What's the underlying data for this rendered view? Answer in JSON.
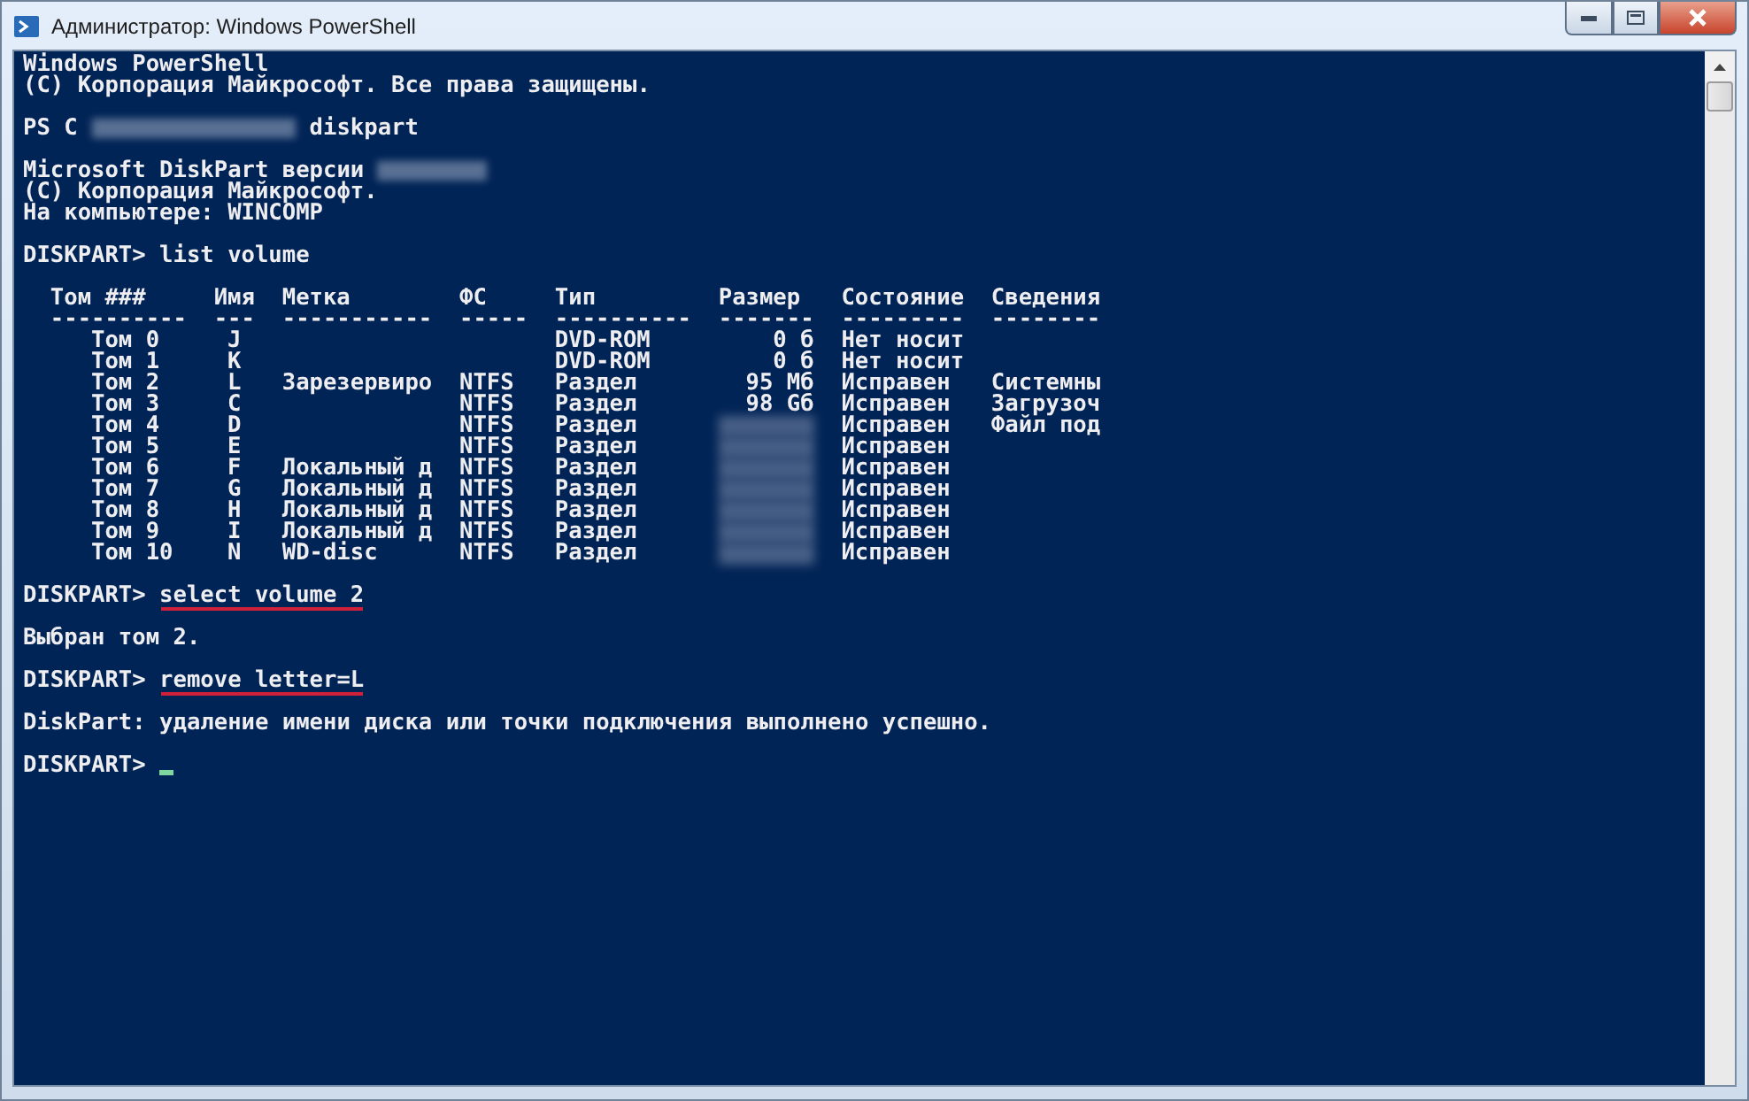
{
  "window": {
    "title": "Администратор: Windows PowerShell"
  },
  "console": {
    "lines_before": [
      {
        "kind": "text",
        "text": "Windows PowerShell"
      },
      {
        "kind": "text",
        "text": "(C) Корпорация Майкрософт. Все права защищены."
      },
      {
        "kind": "blank"
      },
      {
        "kind": "redacted",
        "before": "PS C",
        "after": "diskpart"
      },
      {
        "kind": "blank"
      },
      {
        "kind": "redacted",
        "before": "Microsoft DiskPart версии"
      },
      {
        "kind": "text",
        "text": "(C) Корпорация Майкрософт."
      },
      {
        "kind": "text",
        "text": "На компьютере: WINCOMP"
      },
      {
        "kind": "blank"
      },
      {
        "kind": "command",
        "prompt": "DISKPART>",
        "command": "list volume",
        "underlined": false
      },
      {
        "kind": "blank"
      }
    ],
    "table": {
      "columns": [
        {
          "header": "Том ###",
          "rule": "----------"
        },
        {
          "header": "Имя",
          "rule": "---"
        },
        {
          "header": "Метка",
          "rule": "-----------"
        },
        {
          "header": "ФС",
          "rule": "-----"
        },
        {
          "header": "Тип",
          "rule": "----------"
        },
        {
          "header": "Размер",
          "rule": "-------"
        },
        {
          "header": "Состояние",
          "rule": "---------"
        },
        {
          "header": "Сведения",
          "rule": "--------"
        }
      ],
      "rows": [
        {
          "cells": [
            "Том 0",
            "J",
            "",
            "",
            "DVD-ROM",
            "0 б",
            "Нет носит",
            ""
          ],
          "size_redacted": false
        },
        {
          "cells": [
            "Том 1",
            "K",
            "",
            "",
            "DVD-ROM",
            "0 б",
            "Нет носит",
            ""
          ],
          "size_redacted": false
        },
        {
          "cells": [
            "Том 2",
            "L",
            "Зарезервиро",
            "NTFS",
            "Раздел",
            "95 Мб",
            "Исправен",
            "Системны"
          ],
          "size_redacted": false
        },
        {
          "cells": [
            "Том 3",
            "C",
            "",
            "NTFS",
            "Раздел",
            "98 Gб",
            "Исправен",
            "Загрузоч"
          ],
          "size_redacted": false
        },
        {
          "cells": [
            "Том 4",
            "D",
            "",
            "NTFS",
            "Раздел",
            "",
            "Исправен",
            "Файл под"
          ],
          "size_redacted": true
        },
        {
          "cells": [
            "Том 5",
            "E",
            "",
            "NTFS",
            "Раздел",
            "",
            "Исправен",
            ""
          ],
          "size_redacted": true
        },
        {
          "cells": [
            "Том 6",
            "F",
            "Локальный д",
            "NTFS",
            "Раздел",
            "",
            "Исправен",
            ""
          ],
          "size_redacted": true
        },
        {
          "cells": [
            "Том 7",
            "G",
            "Локальный д",
            "NTFS",
            "Раздел",
            "",
            "Исправен",
            ""
          ],
          "size_redacted": true
        },
        {
          "cells": [
            "Том 8",
            "H",
            "Локальный д",
            "NTFS",
            "Раздел",
            "",
            "Исправен",
            ""
          ],
          "size_redacted": true
        },
        {
          "cells": [
            "Том 9",
            "I",
            "Локальный д",
            "NTFS",
            "Раздел",
            "",
            "Исправен",
            ""
          ],
          "size_redacted": true
        },
        {
          "cells": [
            "Том 10",
            "N",
            "WD-disc",
            "NTFS",
            "Раздел",
            "",
            "Исправен",
            ""
          ],
          "size_redacted": true
        }
      ]
    },
    "lines_after": [
      {
        "kind": "blank"
      },
      {
        "kind": "command",
        "prompt": "DISKPART>",
        "command": "select volume 2",
        "underlined": true
      },
      {
        "kind": "blank"
      },
      {
        "kind": "text",
        "text": "Выбран том 2."
      },
      {
        "kind": "blank"
      },
      {
        "kind": "command",
        "prompt": "DISKPART>",
        "command": "remove letter=L",
        "underlined": true
      },
      {
        "kind": "blank"
      },
      {
        "kind": "text",
        "text": "DiskPart: удаление имени диска или точки подключения выполнено успешно."
      },
      {
        "kind": "blank"
      },
      {
        "kind": "prompt",
        "prompt": "DISKPART>",
        "cursor": true
      }
    ]
  }
}
